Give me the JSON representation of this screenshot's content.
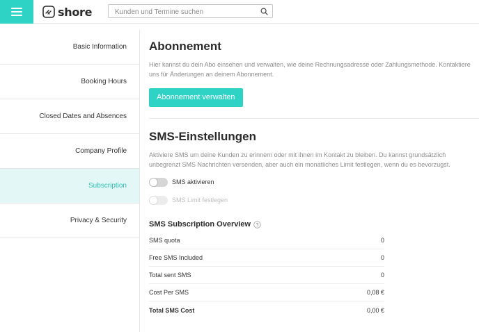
{
  "header": {
    "logo_text": "shore",
    "search_placeholder": "Kunden und Termine suchen"
  },
  "sidebar": {
    "items": [
      {
        "label": "Basic Information",
        "active": false
      },
      {
        "label": "Booking Hours",
        "active": false
      },
      {
        "label": "Closed Dates and Absences",
        "active": false
      },
      {
        "label": "Company Profile",
        "active": false
      },
      {
        "label": "Subscription",
        "active": true
      },
      {
        "label": "Privacy & Security",
        "active": false
      }
    ]
  },
  "subscription": {
    "title": "Abonnement",
    "description": "Hier kannst du dein Abo einsehen und verwalten, wie deine Rechnungsadresse oder Zahlungsmethode. Kontaktiere uns für Änderungen an deinem Abonnement.",
    "manage_button": "Abonnement verwalten"
  },
  "sms": {
    "title": "SMS-Einstellungen",
    "description": "Aktiviere SMS um deine Kunden zu erinnern oder mit ihnen im Kontakt zu bleiben. Du kannst grundsätzlich unbegrenzt SMS Nachrichten versenden, aber auch ein monatliches Limit festlegen, wenn du es bevorzugst.",
    "toggle_activate": "SMS aktivieren",
    "toggle_limit": "SMS Limit festlegen",
    "overview_title": "SMS Subscription Overview",
    "overview": [
      {
        "label": "SMS quota",
        "value": "0"
      },
      {
        "label": "Free SMS Included",
        "value": "0"
      },
      {
        "label": "Total sent SMS",
        "value": "0"
      },
      {
        "label": "Cost Per SMS",
        "value": "0,08 €"
      },
      {
        "label": "Total SMS Cost",
        "value": "0,00 €"
      }
    ]
  },
  "colors": {
    "accent": "#2fd3c6",
    "active_bg": "#e3f8f6",
    "active_text": "#2fbfb3"
  }
}
